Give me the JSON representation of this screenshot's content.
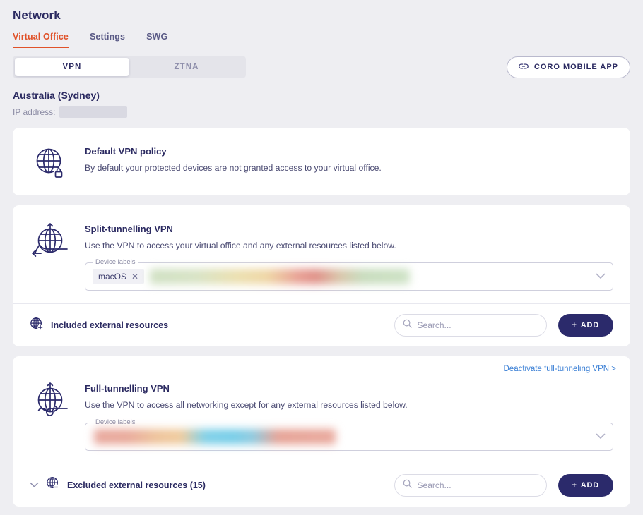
{
  "header": {
    "title": "Network",
    "tabs": [
      {
        "label": "Virtual Office",
        "active": true
      },
      {
        "label": "Settings",
        "active": false
      },
      {
        "label": "SWG",
        "active": false
      }
    ]
  },
  "segmented": {
    "options": [
      {
        "label": "VPN",
        "active": true
      },
      {
        "label": "ZTNA",
        "active": false
      }
    ]
  },
  "mobile_app_button": {
    "label": "CORO MOBILE APP",
    "icon": "link-icon"
  },
  "location": {
    "name": "Australia (Sydney)",
    "ip_label": "IP address:",
    "ip_value": ""
  },
  "cards": {
    "default_policy": {
      "icon": "globe-lock-icon",
      "title": "Default VPN policy",
      "description": "By default your protected devices are not granted access to your virtual office."
    },
    "split_tunnelling": {
      "icon": "globe-split-tunnel-icon",
      "title": "Split-tunnelling VPN",
      "description": "Use the VPN to access your virtual office and any external resources listed below.",
      "labels_field": {
        "legend": "Device labels",
        "chips": [
          {
            "label": "macOS"
          }
        ],
        "chevron": "chevron-down-icon"
      },
      "resources": {
        "icon": "globe-plus-icon",
        "label": "Included external resources",
        "search_placeholder": "Search...",
        "search_value": "",
        "add_label": "ADD"
      }
    },
    "full_tunnelling": {
      "icon": "globe-full-tunnel-icon",
      "deactivate_link": "Deactivate full-tunneling VPN >",
      "title": "Full-tunnelling VPN",
      "description": "Use the VPN to access all networking except for any external resources listed below.",
      "labels_field": {
        "legend": "Device labels",
        "chips": [],
        "chevron": "chevron-down-icon"
      },
      "resources": {
        "expander": "chevron-down-icon",
        "icon": "globe-minus-icon",
        "label": "Excluded external resources (15)",
        "search_placeholder": "Search...",
        "search_value": "",
        "add_label": "ADD"
      }
    }
  },
  "colors": {
    "accent_orange": "#e0522a",
    "navy": "#2b2a6b",
    "link_blue": "#3a7fd5",
    "page_bg": "#eeeef2"
  }
}
